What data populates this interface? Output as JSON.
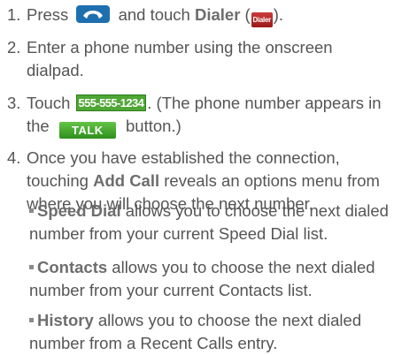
{
  "steps": [
    {
      "num": "1.",
      "a": "Press",
      "b": "and touch",
      "c": "Dialer",
      "d": "(",
      "e": ")."
    },
    {
      "num": "2.",
      "line1": "Enter a phone number using the onscreen",
      "line2": "dialpad."
    },
    {
      "num": "3.",
      "a": "Touch",
      "number": "555-555-1234",
      "b": ". (The phone number appears in",
      "c": "the",
      "talk": "TALK",
      "d": "button.)"
    },
    {
      "num": "4.",
      "line1": "Once you have established the connection,",
      "line2a": "touching",
      "line2b": "Add Call",
      "line2c": "reveals an options menu from",
      "line3": "where you will choose the next number."
    }
  ],
  "bullets": [
    {
      "bold": "Speed Dial",
      "line1": "allows you to choose the next dialed",
      "line2": "number from your current Speed Dial list."
    },
    {
      "bold": "Contacts",
      "line1": "allows you to choose the next dialed",
      "line2": "number from your current Contacts list."
    },
    {
      "bold": "History",
      "line1": "allows you to choose the next dialed",
      "line2": "number from a Recent Calls entry."
    }
  ],
  "icons": {
    "dialer_label": "Dialer",
    "phone_color": "#1d6fae",
    "talk_color": "#3fa82c",
    "number_color": "#4ea634"
  }
}
